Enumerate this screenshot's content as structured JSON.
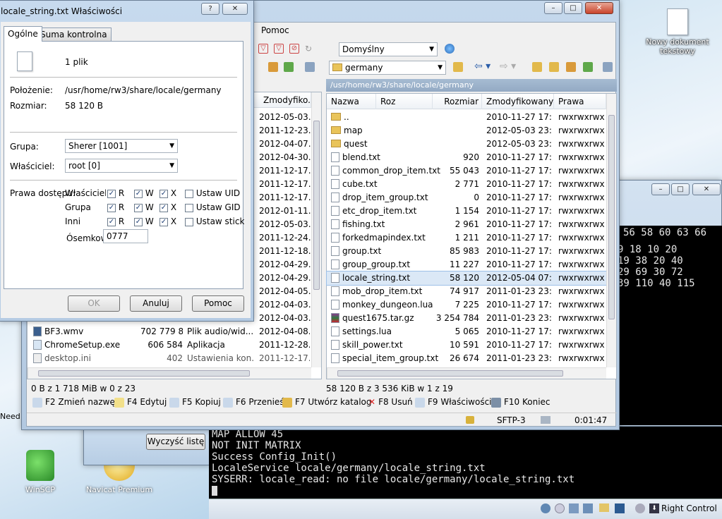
{
  "desktop": {
    "new_doc_label": "Nowy dokument tekstowy",
    "winscp_label": "WinSCP",
    "navicat_label": "Navicat Premium",
    "clear_button": "Wyczyść listę",
    "need_text": "Need"
  },
  "winscp": {
    "menu_help": "Pomoc",
    "profile_combo": "Domyślny",
    "left_panel": {
      "columns": [
        "Zmodyfiko..."
      ],
      "dates": [
        "2012-05-03...",
        "2011-12-23...",
        "2012-04-07...",
        "2012-04-30...",
        "2011-12-17...",
        "2011-12-17...",
        "2011-12-17...",
        "2012-01-11...",
        "2012-05-03...",
        "2011-12-24...",
        "2011-12-18...",
        "2012-04-29...",
        "2012-04-29...",
        "2012-04-05...",
        "2012-04-03...",
        "2012-04-03..."
      ],
      "rows": [
        {
          "name": "BF3.wmv",
          "size": "702 779 8...",
          "type": "Plik audio/wid...",
          "date": "2012-04-08..."
        },
        {
          "name": "ChromeSetup.exe",
          "size": "606 584",
          "type": "Aplikacja",
          "date": "2011-12-28..."
        },
        {
          "name": "desktop.ini",
          "size": "402",
          "type": "Ustawienia kon...",
          "date": "2011-12-17..."
        }
      ],
      "status": "0 B z 1 718 MiB w 0 z 23"
    },
    "right_panel": {
      "folder_combo": "germany",
      "path": "/usr/home/rw3/share/locale/germany",
      "headers": {
        "name": "Nazwa",
        "ext": "Roz",
        "size": "Rozmiar",
        "date": "Zmodyfikowany",
        "rights": "Prawa"
      },
      "rows": [
        {
          "name": "..",
          "size": "",
          "date": "2010-11-27 17:...",
          "rights": "rwxrwxrwx",
          "kind": "up"
        },
        {
          "name": "map",
          "size": "",
          "date": "2012-05-03 23:...",
          "rights": "rwxrwxrwx",
          "kind": "folder"
        },
        {
          "name": "quest",
          "size": "",
          "date": "2012-05-03 23:...",
          "rights": "rwxrwxrwx",
          "kind": "folder"
        },
        {
          "name": "blend.txt",
          "size": "920",
          "date": "2010-11-27 17:...",
          "rights": "rwxrwxrwx",
          "kind": "file"
        },
        {
          "name": "common_drop_item.txt",
          "size": "55 043",
          "date": "2010-11-27 17:...",
          "rights": "rwxrwxrwx",
          "kind": "file"
        },
        {
          "name": "cube.txt",
          "size": "2 771",
          "date": "2010-11-27 17:...",
          "rights": "rwxrwxrwx",
          "kind": "file"
        },
        {
          "name": "drop_item_group.txt",
          "size": "0",
          "date": "2010-11-27 17:...",
          "rights": "rwxrwxrwx",
          "kind": "file"
        },
        {
          "name": "etc_drop_item.txt",
          "size": "1 154",
          "date": "2010-11-27 17:...",
          "rights": "rwxrwxrwx",
          "kind": "file"
        },
        {
          "name": "fishing.txt",
          "size": "2 961",
          "date": "2010-11-27 17:...",
          "rights": "rwxrwxrwx",
          "kind": "file"
        },
        {
          "name": "forkedmapindex.txt",
          "size": "1 211",
          "date": "2010-11-27 17:...",
          "rights": "rwxrwxrwx",
          "kind": "file"
        },
        {
          "name": "group.txt",
          "size": "85 983",
          "date": "2010-11-27 17:...",
          "rights": "rwxrwxrwx",
          "kind": "file"
        },
        {
          "name": "group_group.txt",
          "size": "11 227",
          "date": "2010-11-27 17:...",
          "rights": "rwxrwxrwx",
          "kind": "file"
        },
        {
          "name": "locale_string.txt",
          "size": "58 120",
          "date": "2012-05-04 07:...",
          "rights": "rwxrwxrwx",
          "kind": "file",
          "selected": true
        },
        {
          "name": "mob_drop_item.txt",
          "size": "74 917",
          "date": "2011-01-23 23:...",
          "rights": "rwxrwxrwx",
          "kind": "file"
        },
        {
          "name": "monkey_dungeon.lua",
          "size": "7 225",
          "date": "2010-11-27 17:...",
          "rights": "rwxrwxrwx",
          "kind": "file"
        },
        {
          "name": "quest1675.tar.gz",
          "size": "3 254 784",
          "date": "2011-01-23 23:...",
          "rights": "rwxrwxrwx",
          "kind": "archive"
        },
        {
          "name": "settings.lua",
          "size": "5 065",
          "date": "2010-11-27 17:...",
          "rights": "rwxrwxrwx",
          "kind": "file"
        },
        {
          "name": "skill_power.txt",
          "size": "10 591",
          "date": "2010-11-27 17:...",
          "rights": "rwxrwxrwx",
          "kind": "file"
        },
        {
          "name": "special_item_group.txt",
          "size": "26 674",
          "date": "2011-01-23 23:...",
          "rights": "rwxrwxrwx",
          "kind": "file"
        }
      ],
      "status": "58 120 B z 3 536 KiB w 1 z 19"
    },
    "fkeys": [
      "F2 Zmień nazwę",
      "F4 Edytuj",
      "F5 Kopiuj",
      "F6 Przenieś",
      "F7 Utwórz katalog",
      "F8 Usuń",
      "F9 Właściwości",
      "F10 Koniec"
    ],
    "status_protocol": "SFTP-3",
    "status_time": "0:01:47"
  },
  "props": {
    "title": "locale_string.txt Właściwości",
    "tabs": [
      "Ogólne",
      "Suma kontrolna"
    ],
    "file_count": "1 plik",
    "location_label": "Położenie:",
    "location_value": "/usr/home/rw3/share/locale/germany",
    "size_label": "Rozmiar:",
    "size_value": "58 120 B",
    "group_label": "Grupa:",
    "group_value": "Sherer [1001]",
    "owner_label": "Właściciel:",
    "owner_value": "root [0]",
    "rights_label": "Prawa dostępu:",
    "perm_rows": [
      {
        "label": "Właściciel",
        "r": "R",
        "w": "W",
        "x": "X",
        "special": "Ustaw UID"
      },
      {
        "label": "Grupa",
        "r": "R",
        "w": "W",
        "x": "X",
        "special": "Ustaw GID"
      },
      {
        "label": "Inni",
        "r": "R",
        "w": "W",
        "x": "X",
        "special": "Ustaw stick"
      }
    ],
    "octal_label": "Ósemkowo",
    "octal_value": "0777",
    "ok": "OK",
    "cancel": "Anuluj",
    "help": "Pomoc"
  },
  "terminal": {
    "numbers": [
      "56 58 60 63 66",
      "9 18     10 20",
      "19 38    20 40",
      "29 69    30 72",
      "39 110   40 115"
    ],
    "lines": [
      "MAP ALLOW 45",
      "NOT INIT MATRIX",
      "Success Config_Init()",
      "LocaleService locale/germany/locale_string.txt",
      "SYSERR: locale_read: no file locale/germany/locale_string.txt"
    ],
    "right_control": "Right Control"
  }
}
